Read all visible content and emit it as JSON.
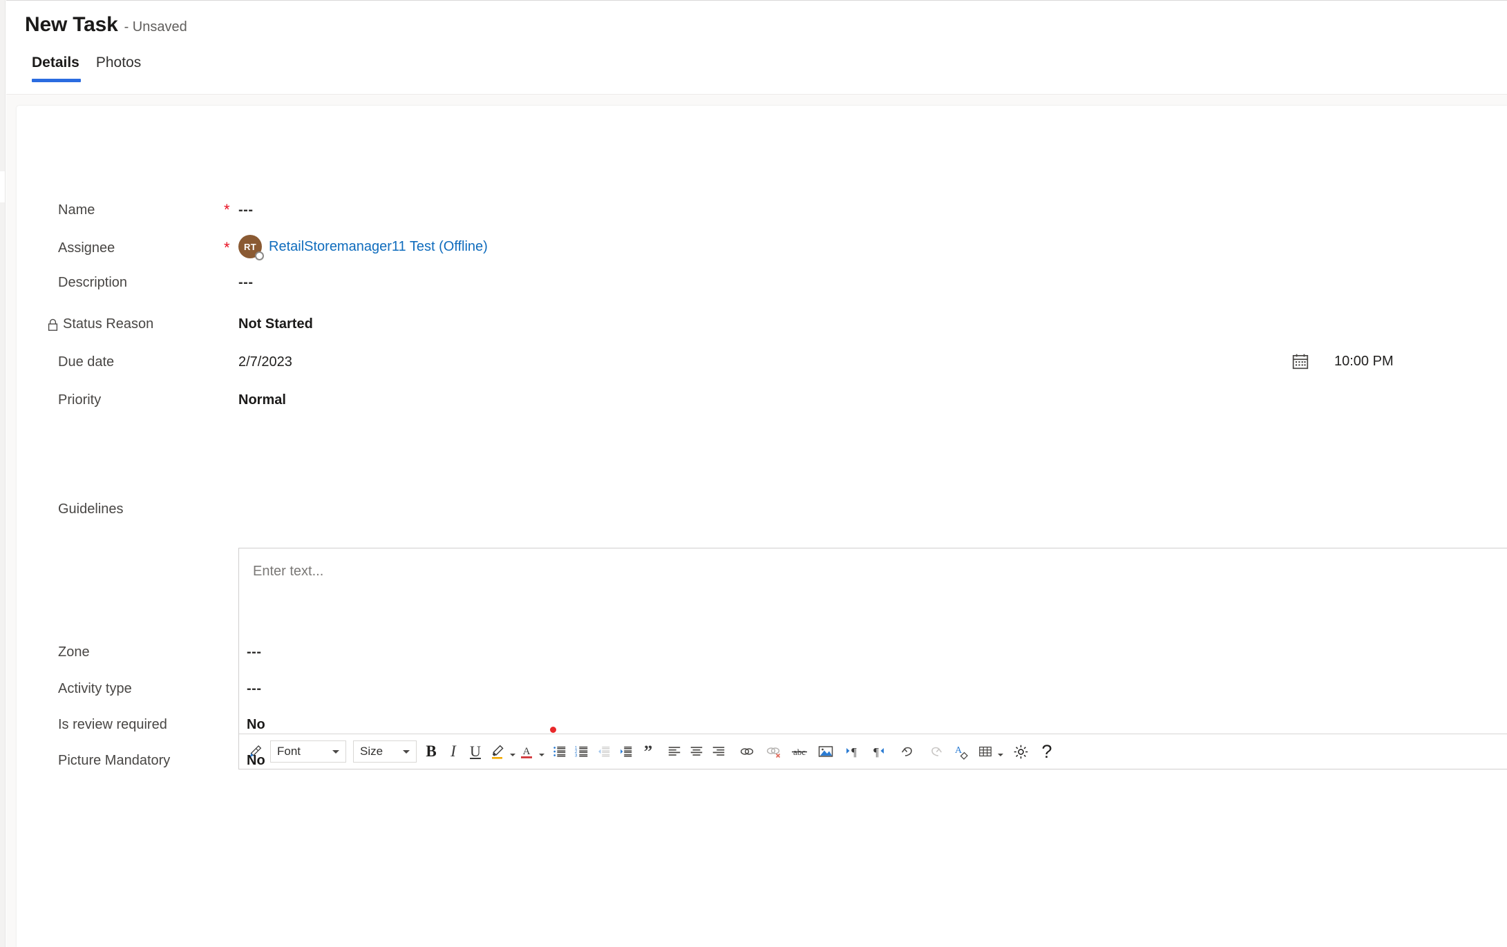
{
  "header": {
    "title": "New Task",
    "subtitle": "- Unsaved",
    "tabs": [
      {
        "label": "Details",
        "active": true
      },
      {
        "label": "Photos",
        "active": false
      }
    ]
  },
  "form": {
    "fields": [
      {
        "label": "Name",
        "required": true,
        "value": "---",
        "style": "dashes"
      },
      {
        "label": "Assignee",
        "required": true,
        "value": "RetailStoremanager11 Test (Offline)",
        "avatar_initials": "RT",
        "avatar_color": "#8a5a33",
        "link_color": "#0f6cbd",
        "style": "person"
      },
      {
        "label": "Description",
        "required": false,
        "value": "---",
        "style": "dashes"
      },
      {
        "label": "Status Reason",
        "required": false,
        "value": "Not Started",
        "locked": true,
        "lock_icon": "lock-icon",
        "style": "bold"
      },
      {
        "label": "Due date",
        "required": false,
        "value": "2/7/2023",
        "time": "10:00 PM",
        "calendar_icon": "calendar-icon",
        "style": "plain"
      },
      {
        "label": "Priority",
        "required": false,
        "value": "Normal",
        "style": "bold"
      },
      {
        "label": "Guidelines",
        "required": false,
        "style": "richtext"
      },
      {
        "label": "Zone",
        "required": false,
        "value": "---",
        "style": "dashes"
      },
      {
        "label": "Activity type",
        "required": false,
        "value": "---",
        "style": "dashes"
      },
      {
        "label": "Is review required",
        "required": false,
        "value": "No",
        "style": "bold"
      },
      {
        "label": "Picture Mandatory",
        "required": false,
        "value": "No",
        "style": "bold"
      }
    ],
    "required_marker": "*"
  },
  "editor": {
    "placeholder": "Enter text...",
    "font_select": {
      "label": "Font"
    },
    "size_select": {
      "label": "Size"
    },
    "toolbar": [
      {
        "name": "format-painter-icon",
        "title": "Format painter"
      },
      {
        "name": "font-family-select",
        "title": "Font"
      },
      {
        "name": "font-size-select",
        "title": "Size"
      },
      {
        "name": "bold-icon",
        "title": "Bold",
        "glyph": "B"
      },
      {
        "name": "italic-icon",
        "title": "Italic",
        "glyph": "I"
      },
      {
        "name": "underline-icon",
        "title": "Underline",
        "glyph": "U"
      },
      {
        "name": "highlight-color-icon",
        "title": "Highlight color"
      },
      {
        "name": "font-color-icon",
        "title": "Font color",
        "glyph": "A"
      },
      {
        "name": "bulleted-list-icon",
        "title": "Bulleted list"
      },
      {
        "name": "numbered-list-icon",
        "title": "Numbered list"
      },
      {
        "name": "decrease-indent-icon",
        "title": "Decrease indent"
      },
      {
        "name": "increase-indent-icon",
        "title": "Increase indent"
      },
      {
        "name": "blockquote-icon",
        "title": "Block quote"
      },
      {
        "name": "align-left-icon",
        "title": "Align left"
      },
      {
        "name": "align-center-icon",
        "title": "Align center"
      },
      {
        "name": "align-right-icon",
        "title": "Align right"
      },
      {
        "name": "insert-link-icon",
        "title": "Insert link"
      },
      {
        "name": "remove-link-icon",
        "title": "Remove link"
      },
      {
        "name": "strikethrough-icon",
        "title": "Strikethrough",
        "glyph": "abc"
      },
      {
        "name": "insert-image-icon",
        "title": "Insert image"
      },
      {
        "name": "ltr-direction-icon",
        "title": "Left to right"
      },
      {
        "name": "rtl-direction-icon",
        "title": "Right to left"
      },
      {
        "name": "undo-icon",
        "title": "Undo"
      },
      {
        "name": "redo-icon",
        "title": "Redo"
      },
      {
        "name": "clear-formatting-icon",
        "title": "Clear formatting"
      },
      {
        "name": "insert-table-icon",
        "title": "Insert table"
      },
      {
        "name": "settings-gear-icon",
        "title": "Settings"
      },
      {
        "name": "help-icon",
        "title": "Help",
        "glyph": "?"
      }
    ]
  },
  "colors": {
    "accent_blue": "#2b6ce0",
    "link_blue": "#0f6cbd",
    "required_red": "#e81123",
    "avatar_brown": "#8a5a33",
    "page_bg": "#faf9f8",
    "card_bg": "#ffffff"
  }
}
